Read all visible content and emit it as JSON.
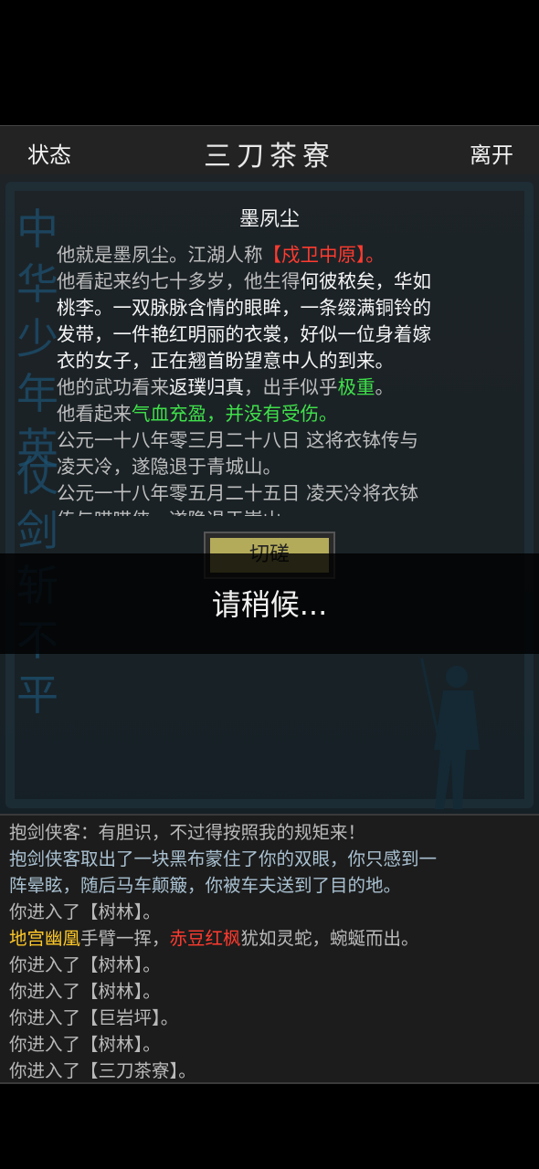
{
  "topbar": {
    "status_label": "状态",
    "title": "三刀茶寮",
    "leave_label": "离开"
  },
  "background": {
    "calligraphy_1": "中华少年英",
    "calligraphy_2": "仗剑斩不平"
  },
  "npc": {
    "name": "墨夙尘",
    "l1a": "他就是墨夙尘。江湖人称",
    "l1b": "【戍卫中原】。",
    "l2a": "他看起来约七十多岁，他生得",
    "l2b": "何彼秾矣，华如",
    "l3": "桃李。一双脉脉含情的眼眸，一条缀满铜铃的",
    "l4": "发带，一件艳红明丽的衣裳，好似一位身着嫁",
    "l5": "衣的女子，正在翘首盼望意中人的到来。",
    "l6a": "他的武功看来",
    "l6b": "返璞归真",
    "l6c": "，出手似乎",
    "l6d": "极重",
    "l6e": "。",
    "l7a": "他看起来",
    "l7b": "气血充盈，并没有受伤。",
    "l8": "公元一十八年零三月二十八日 这将衣钵传与",
    "l9": "凌天冷，遂隐退于青城山。",
    "l10": "公元一十八年零五月二十五日 凌天冷将衣钵",
    "l11": "传与喵喵侠，遂隐退于嵩山"
  },
  "actions": {
    "spar_label": "切磋"
  },
  "overlay": {
    "text": "请稍候..."
  },
  "log": {
    "m1": "抱剑侠客：有胆识，不过得按照我的规矩来！",
    "m2a": "抱剑侠客取出了一块黑布蒙住了你的双眼，你只感到一",
    "m2b": "阵晕眩，随后马车颠簸，你被车夫送到了目的地。",
    "m3": "你进入了【树林】。",
    "m4a": "地宫幽凰",
    "m4b": "手臂一挥，",
    "m4c": "赤豆红枫",
    "m4d": "犹如灵蛇，蜿蜒而出。",
    "m5": "你进入了【树林】。",
    "m6": "你进入了【树林】。",
    "m7": "你进入了【巨岩坪】。",
    "m8": "你进入了【树林】。",
    "m9": "你进入了【三刀茶寮】。"
  }
}
